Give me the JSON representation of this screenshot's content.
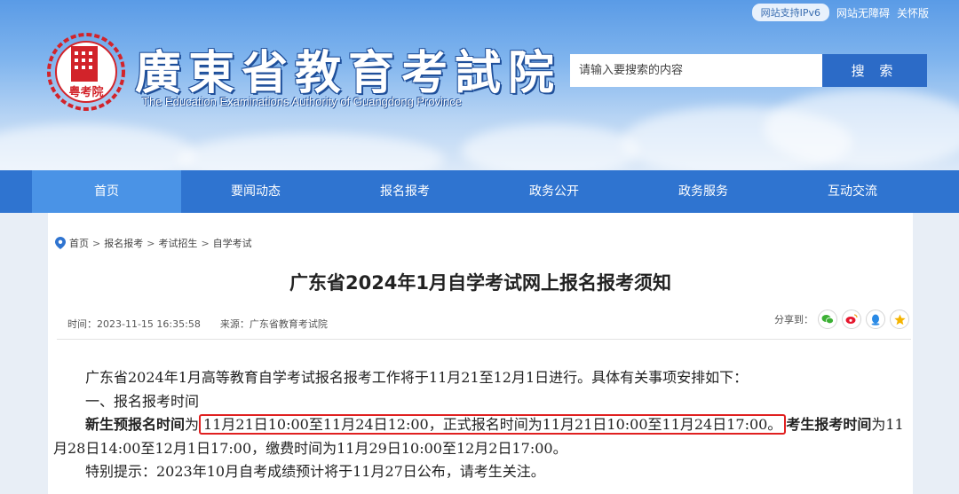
{
  "top_bar": {
    "ipv6_badge": "网站支持IPv6",
    "accessibility_link": "网站无障碍",
    "care_link": "关怀版"
  },
  "header": {
    "title": "廣東省教育考試院",
    "subtitle": "The Education Examinations Authority of Guangdong Province",
    "logo_text": "粤考院",
    "search_placeholder": "请输入要搜索的内容",
    "search_button": "搜 索"
  },
  "nav": {
    "items": [
      {
        "label": "首页",
        "active": true
      },
      {
        "label": "要闻动态"
      },
      {
        "label": "报名报考"
      },
      {
        "label": "政务公开"
      },
      {
        "label": "政务服务"
      },
      {
        "label": "互动交流"
      }
    ]
  },
  "breadcrumb": {
    "items": [
      "首页",
      "报名报考",
      "考试招生",
      "自学考试"
    ],
    "separator": ">"
  },
  "article": {
    "title": "广东省2024年1月自学考试网上报名报考须知",
    "time": "时间：2023-11-15 16:35:58",
    "source": "来源：广东省教育考试院",
    "share_label": "分享到：",
    "paragraphs": {
      "p1": "广东省2024年1月高等教育自学考试报名报考工作将于11月21至12月1日进行。具体有关事项安排如下：",
      "p2": "一、报名报考时间",
      "p3_bold1": "新生预报名时间",
      "p3_text1": "为",
      "p3_highlight": "11月21日10:00至11月24日12:00，正式报名时间为11月21日10:00至11月24日17:00。",
      "p3_bold2": "考生报考时间",
      "p3_text2": "为11",
      "p4": "月28日14:00至12月1日17:00，缴费时间为11月29日10:00至12月2日17:00。",
      "p5": "特别提示：2023年10月自考成绩预计将于11月27日公布，请考生关注。"
    }
  },
  "colors": {
    "nav_bg": "#2f74d0",
    "nav_active": "#4a93e6",
    "search_button": "#2c6bc7",
    "highlight_border": "#e02020"
  }
}
